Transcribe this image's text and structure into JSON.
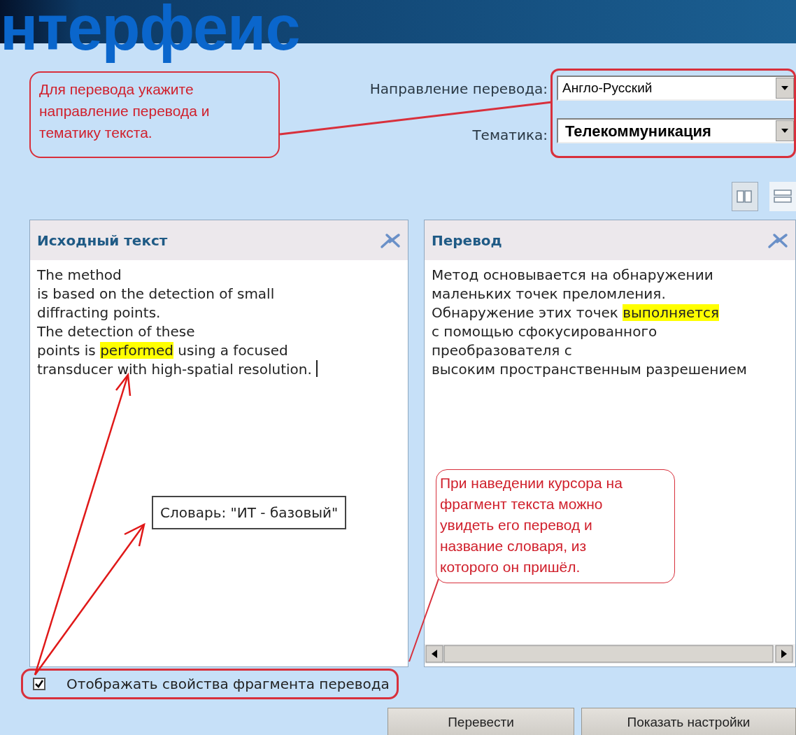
{
  "slide_title": "нтерфеис",
  "callouts": [
    {
      "text": "Для перевода укажите направление перевода и тематику текста."
    },
    {
      "text": "При наведении курсора на фрагмент текста можно увидеть его перевод и название словаря, из которого он пришёл."
    }
  ],
  "settings": [
    {
      "label": "Направление перевода:",
      "value": "Англо-Русский",
      "emphasized": false
    },
    {
      "label": "Тематика:",
      "value": "Телекоммуникация",
      "emphasized": true
    }
  ],
  "view_modes": [
    {
      "kind": "columns",
      "selected": true
    },
    {
      "kind": "rows",
      "selected": false
    }
  ],
  "panels": [
    {
      "title": "Исходный текст",
      "cursor": true,
      "scrollbar": false,
      "lines": [
        [
          {
            "text": "The method",
            "highlighted": false
          }
        ],
        [
          {
            "text": "is based on the detection of small",
            "highlighted": false
          }
        ],
        [
          {
            "text": "diffracting points.",
            "highlighted": false
          }
        ],
        [
          {
            "text": "The detection of these",
            "highlighted": false
          }
        ],
        [
          {
            "text": "points is ",
            "highlighted": false
          },
          {
            "text": "performed",
            "highlighted": true
          },
          {
            "text": " using a focused",
            "highlighted": false
          }
        ],
        [
          {
            "text": "transducer with high-spatial resolution.",
            "highlighted": false
          }
        ]
      ]
    },
    {
      "title": "Перевод",
      "cursor": false,
      "scrollbar": true,
      "lines": [
        [
          {
            "text": "Метод основывается на обнаружении",
            "highlighted": false
          }
        ],
        [
          {
            "text": "маленьких точек преломления.",
            "highlighted": false
          }
        ],
        [
          {
            "text": "Обнаружение этих точек ",
            "highlighted": false
          },
          {
            "text": "выполняется",
            "highlighted": true
          }
        ],
        [
          {
            "text": "с помощью сфокусированного",
            "highlighted": false
          }
        ],
        [
          {
            "text": "преобразователя с",
            "highlighted": false
          }
        ],
        [
          {
            "text": "высоким пространственным разрешением",
            "highlighted": false
          }
        ]
      ]
    }
  ],
  "tooltip": {
    "text": "Словарь: \"ИТ - базовый\""
  },
  "option": {
    "label": "Отображать свойства фрагмента перевода",
    "checked": true
  },
  "buttons": [
    "Перевести",
    "Показать настройки"
  ]
}
